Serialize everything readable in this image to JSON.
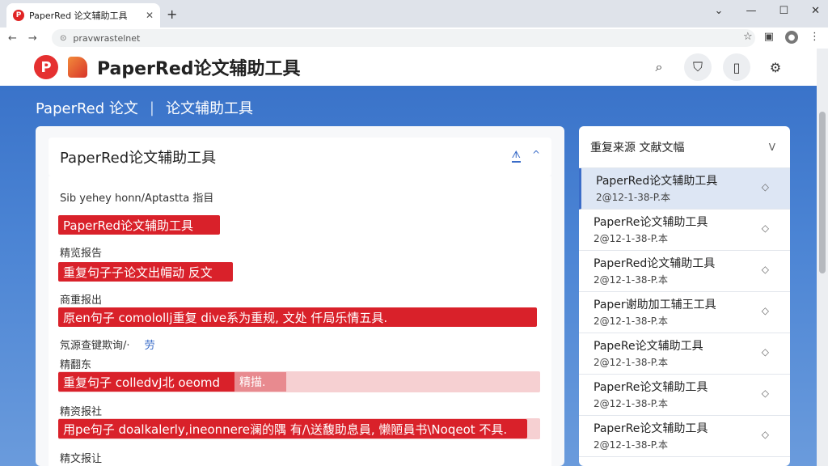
{
  "browser": {
    "tab_title": "PaperRed 论文辅助工具",
    "tab_favicon": "P",
    "url": "pravwrastelnet"
  },
  "app": {
    "logo_letter": "P",
    "title": "PaperRed论文辅助工具",
    "breadcrumb_home": "PaperRed 论文",
    "breadcrumb_page": "论文辅助工具"
  },
  "panel": {
    "title": "PaperRed论文辅助工具",
    "ctl_label": "ᗑ",
    "collapse_label": "^",
    "intro": "Sib yehey honn/Aptastta 指目",
    "entries": [
      {
        "kind": "highlight",
        "text": "PaperRed论文辅助工具"
      },
      {
        "kind": "label",
        "text": "精览报告"
      },
      {
        "kind": "highlight",
        "text": "重复句子子论文出帽动 反文"
      },
      {
        "kind": "label",
        "text": "商重报出"
      },
      {
        "kind": "highlight",
        "text": "原en句子 comolollj重复 dive系为重规, 文处 仟局乐情五具."
      },
      {
        "kind": "label",
        "text": "氖源查键欺询/·",
        "suffix": "劳"
      },
      {
        "kind": "label",
        "text": "精翻东"
      },
      {
        "kind": "highlight",
        "text": "重复句子 colledvJ北 oeomd",
        "tag": "精描."
      },
      {
        "kind": "label",
        "text": "精资报社"
      },
      {
        "kind": "highlight",
        "text": "用pe句子 doalkalerly,ineonnere澜的隅 有/\\送馥助息員, 懒陋員书\\Noqeot 不具."
      },
      {
        "kind": "label",
        "text": "精文报让"
      }
    ]
  },
  "side": {
    "title": "重复来源  文献文幅",
    "chevron": "ᐯ",
    "items": [
      {
        "title": "PaperRed论文辅助工具",
        "date": "2@12-1-38-P.本"
      },
      {
        "title": "PaperRe论文辅助工具",
        "date": "2@12-1-38-P.本"
      },
      {
        "title": "PaperRed论文辅助工具",
        "date": "2@12-1-38-P.本"
      },
      {
        "title": "Paper谢助加工辅王工具",
        "date": "2@12-1-38-P.本"
      },
      {
        "title": "PapeRe论文辅助工具",
        "date": "2@12-1-38-P.本"
      },
      {
        "title": "PaperRe论文辅助工具",
        "date": "2@12-1-38-P.本"
      },
      {
        "title": "PaperRe论文辅助工具",
        "date": "2@12-1-38-P.本"
      }
    ]
  }
}
